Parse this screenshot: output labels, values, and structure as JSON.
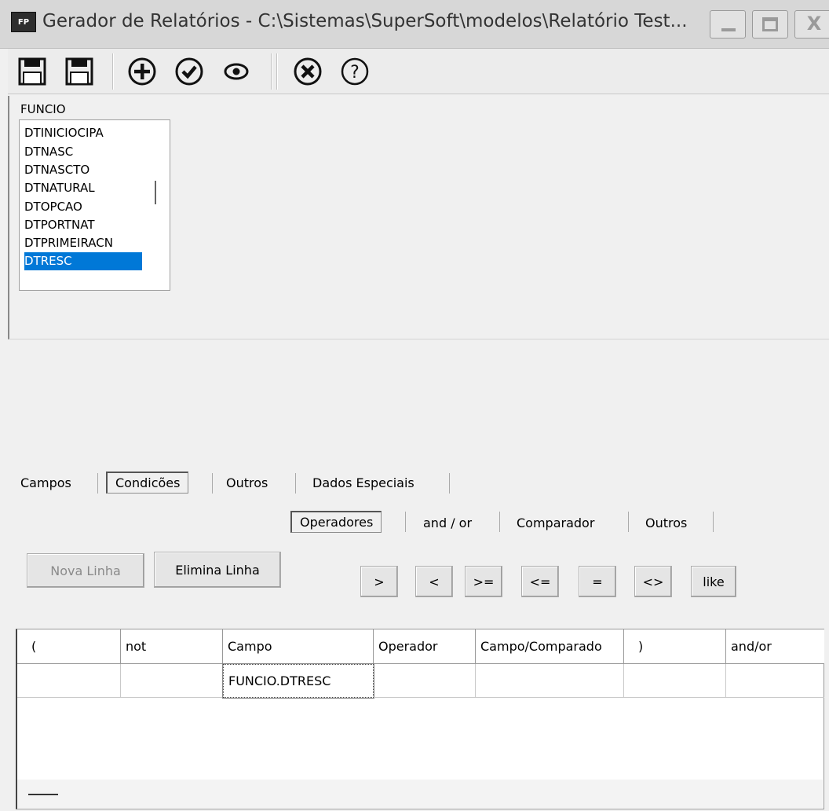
{
  "window": {
    "title": "Gerador de Relatórios - C:\\Sistemas\\SuperSoft\\modelos\\Relatório Test...",
    "app_icon_text": "FP"
  },
  "toolbar": {
    "buttons": [
      {
        "name": "save-icon"
      },
      {
        "name": "save-as-icon"
      },
      {
        "name": "add-circle-icon"
      },
      {
        "name": "check-circle-icon"
      },
      {
        "name": "eye-icon"
      },
      {
        "name": "cancel-circle-icon"
      },
      {
        "name": "help-icon"
      }
    ]
  },
  "fields": {
    "table_name": "FUNCIO",
    "items": [
      "DTINICIOCIPA",
      "DTNASC",
      "DTNASCTO",
      "DTNATURAL",
      "DTOPCAO",
      "DTPORTNAT",
      "DTPRIMEIRACN",
      "DTRESC"
    ],
    "selected": "DTRESC"
  },
  "tabs_main": [
    "Campos",
    "Condicões",
    "Outros",
    "Dados Especiais"
  ],
  "tabs_sub": [
    "Operadores",
    "and / or",
    "Comparador",
    "Outros"
  ],
  "buttons": {
    "new_line": "Nova Linha",
    "delete_line": "Elimina Linha"
  },
  "operators": [
    ">",
    "<",
    ">=",
    "<=",
    "=",
    "<>",
    "like"
  ],
  "grid": {
    "headers": [
      "(",
      "not",
      "Campo",
      "Operador",
      "Campo/Comparado",
      ")",
      "and/or"
    ],
    "rows": [
      [
        "",
        "",
        "FUNCIO.DTRESC",
        "",
        "",
        "",
        ""
      ]
    ]
  },
  "colors": {
    "selection": "#0078d7",
    "titlebar": "#d7d7d7"
  }
}
